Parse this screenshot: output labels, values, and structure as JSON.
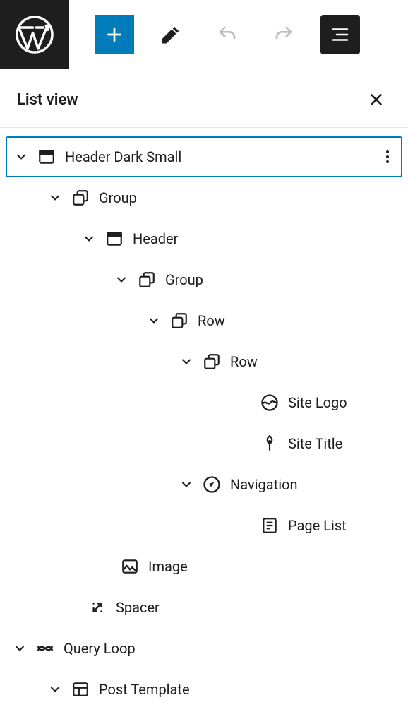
{
  "panel_title": "List view",
  "tree": [
    {
      "label": "Header Dark Small",
      "icon": "header",
      "indent": 0,
      "expandable": true,
      "selected": true
    },
    {
      "label": "Group",
      "icon": "group",
      "indent": 1,
      "expandable": true
    },
    {
      "label": "Header",
      "icon": "header",
      "indent": 2,
      "expandable": true
    },
    {
      "label": "Group",
      "icon": "group",
      "indent": 3,
      "expandable": true
    },
    {
      "label": "Row",
      "icon": "group",
      "indent": 4,
      "expandable": true
    },
    {
      "label": "Row",
      "icon": "group",
      "indent": 5,
      "expandable": true
    },
    {
      "label": "Site Logo",
      "icon": "sitelogo",
      "indent": 6,
      "expandable": false
    },
    {
      "label": "Site Title",
      "icon": "sitetitle",
      "indent": 6,
      "expandable": false
    },
    {
      "label": "Navigation",
      "icon": "navigation",
      "indent": 5,
      "expandable": true
    },
    {
      "label": "Page List",
      "icon": "pagelist",
      "indent": 6,
      "expandable": false
    },
    {
      "label": "Image",
      "icon": "image",
      "indent": 3,
      "expandable": false,
      "noChev": true
    },
    {
      "label": "Spacer",
      "icon": "spacer",
      "indent": 2,
      "expandable": false,
      "noChev": true
    },
    {
      "label": "Query Loop",
      "icon": "queryloop",
      "indent": 0,
      "expandable": true
    },
    {
      "label": "Post Template",
      "icon": "posttemplate",
      "indent": 1,
      "expandable": true
    }
  ]
}
